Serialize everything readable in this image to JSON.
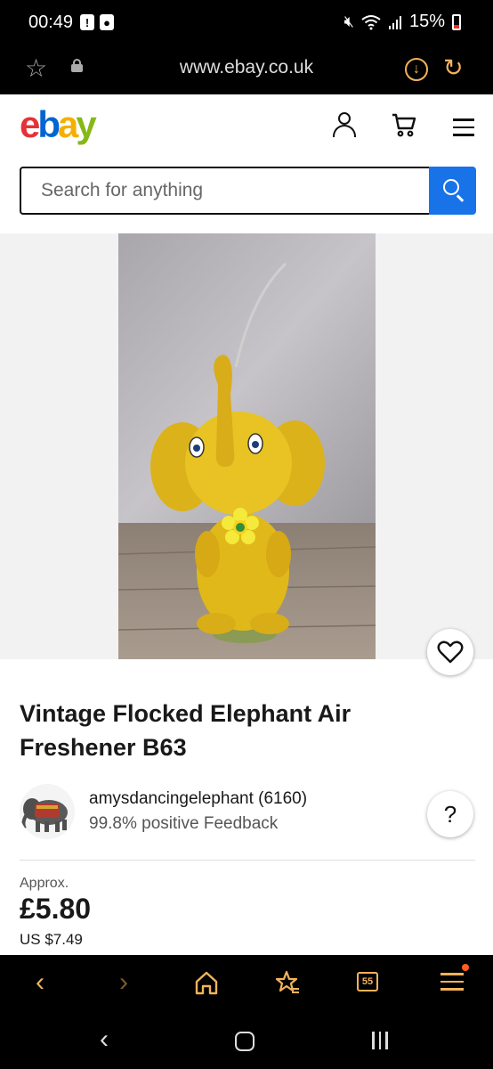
{
  "status_bar": {
    "time": "00:49",
    "left_icons": [
      "alert-icon",
      "record-icon"
    ],
    "right_icons": [
      "mute-icon",
      "wifi-icon",
      "signal-icon"
    ],
    "battery": "15%"
  },
  "browser": {
    "url": "www.ebay.co.uk",
    "icons": [
      "star-icon",
      "lock-icon",
      "download-icon",
      "refresh-icon"
    ],
    "accent_color": "#f3b25c"
  },
  "header": {
    "logo": {
      "e": "e",
      "b": "b",
      "a": "a",
      "y": "y"
    },
    "icons": [
      "user-icon",
      "cart-icon",
      "menu-icon"
    ]
  },
  "search": {
    "placeholder": "Search for anything",
    "value": "",
    "button_color": "#1973e8"
  },
  "listing": {
    "title": "Vintage Flocked Elephant Air Freshener B63",
    "seller_name": "amysdancingelephant (6160)",
    "seller_feedback": "99.8% positive Feedback",
    "help_label": "?",
    "price_approx": "Approx.",
    "price": "£5.80",
    "price_usd": "US $7.49"
  },
  "browser_toolbar": {
    "tab_count": "55",
    "icons": [
      "back-icon",
      "forward-icon",
      "home-icon",
      "bookmarks-icon",
      "tabs-icon",
      "menu-icon"
    ]
  },
  "android_nav": {
    "icons": [
      "back-icon",
      "home-icon",
      "recent-apps-icon"
    ]
  }
}
